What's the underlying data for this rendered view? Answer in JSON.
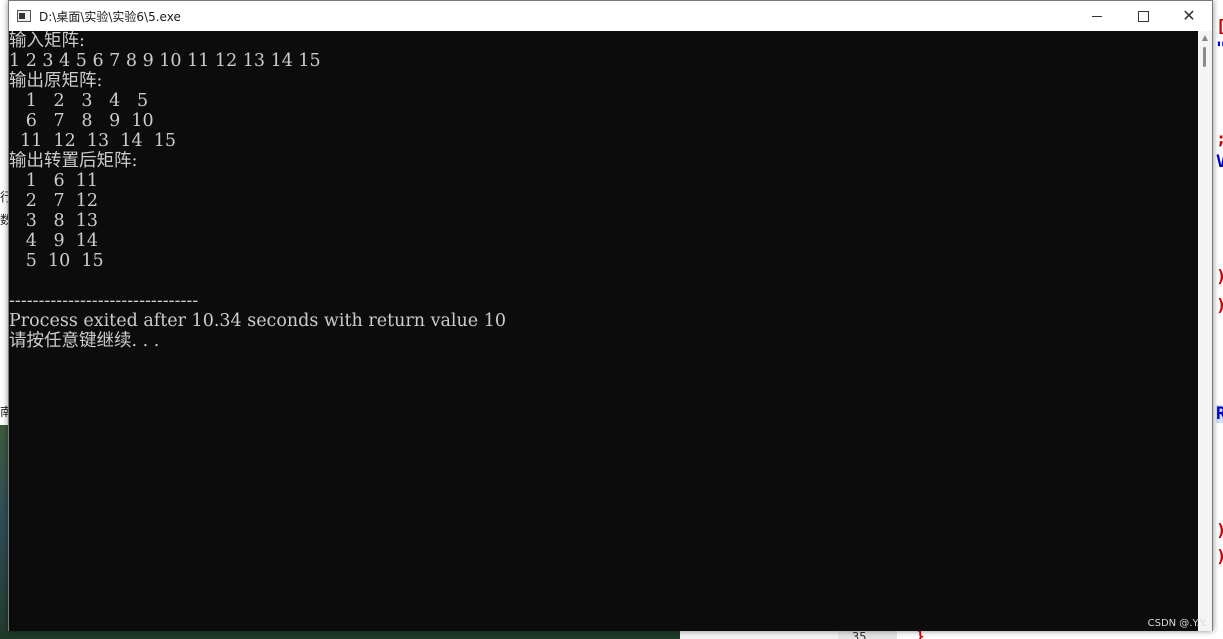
{
  "window": {
    "title": "D:\\桌面\\实验\\实验6\\5.exe",
    "controls": {
      "minimize": "minimize",
      "maximize": "maximize",
      "close": "✕"
    }
  },
  "console": {
    "lines": [
      "输入矩阵:",
      "1 2 3 4 5 6 7 8 9 10 11 12 13 14 15",
      "输出原矩阵:",
      "   1   2   3   4   5",
      "   6   7   8   9  10",
      "  11  12  13  14  15",
      "输出转置后矩阵:",
      "   1   6  11",
      "   2   7  12",
      "   3   8  13",
      "   4   9  14",
      "   5  10  15",
      "",
      "--------------------------------",
      "Process exited after 10.34 seconds with return value 10",
      "请按任意键继续. . ."
    ]
  },
  "background": {
    "left_glyphs": [
      "行",
      "数",
      "南"
    ],
    "right_glyphs": [
      "[",
      "\"",
      ";",
      "V",
      ")",
      ")",
      "R",
      ")",
      ")"
    ],
    "bottom_line_number": "35",
    "bottom_brace": "}"
  },
  "watermark": "CSDN @.Y.Y.",
  "colors": {
    "console_bg": "#0c0c0c",
    "console_text": "#cccccc",
    "titlebar_bg": "#ffffff",
    "editor_red": "#cc0000",
    "editor_blue": "#0000cc"
  }
}
